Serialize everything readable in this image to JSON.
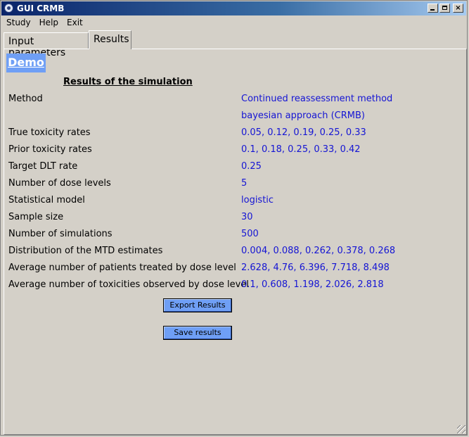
{
  "window": {
    "title": "GUI CRMB",
    "min_glyph": "",
    "max_glyph": "",
    "close_glyph": "×"
  },
  "menu": {
    "items": [
      "Study",
      "Help",
      "Exit"
    ]
  },
  "tabs": [
    {
      "label": "Input parameters",
      "active": false
    },
    {
      "label": "Results",
      "active": true
    }
  ],
  "demo_label": "Demo",
  "results_title": "Results of the simulation",
  "rows": [
    {
      "label": "Method",
      "value": "Continued reassessment method"
    },
    {
      "label": "",
      "value": "bayesian approach (CRMB)"
    },
    {
      "label": "True toxicity rates",
      "value": "0.05, 0.12, 0.19, 0.25, 0.33"
    },
    {
      "label": "Prior toxicity rates",
      "value": "0.1, 0.18, 0.25, 0.33, 0.42"
    },
    {
      "label": "Target DLT rate",
      "value": "0.25"
    },
    {
      "label": "Number of dose levels",
      "value": "5"
    },
    {
      "label": "Statistical model",
      "value": "logistic"
    },
    {
      "label": "Sample size",
      "value": "30"
    },
    {
      "label": "Number of simulations",
      "value": "500"
    },
    {
      "label": "Distribution of the MTD estimates",
      "value": "0.004, 0.088, 0.262, 0.378, 0.268"
    },
    {
      "label": "Average number of patients treated by dose level",
      "value": "2.628, 4.76, 6.396, 7.718, 8.498"
    },
    {
      "label": "Average number of toxicities observed by dose level",
      "value": "0.1, 0.608, 1.198, 2.026, 2.818"
    }
  ],
  "buttons": {
    "export": "Export Results",
    "save": "Save results"
  },
  "colors": {
    "value_text": "#1515d4",
    "button_bg": "#6f9ff5",
    "demo_bg": "#6f9ff5"
  }
}
